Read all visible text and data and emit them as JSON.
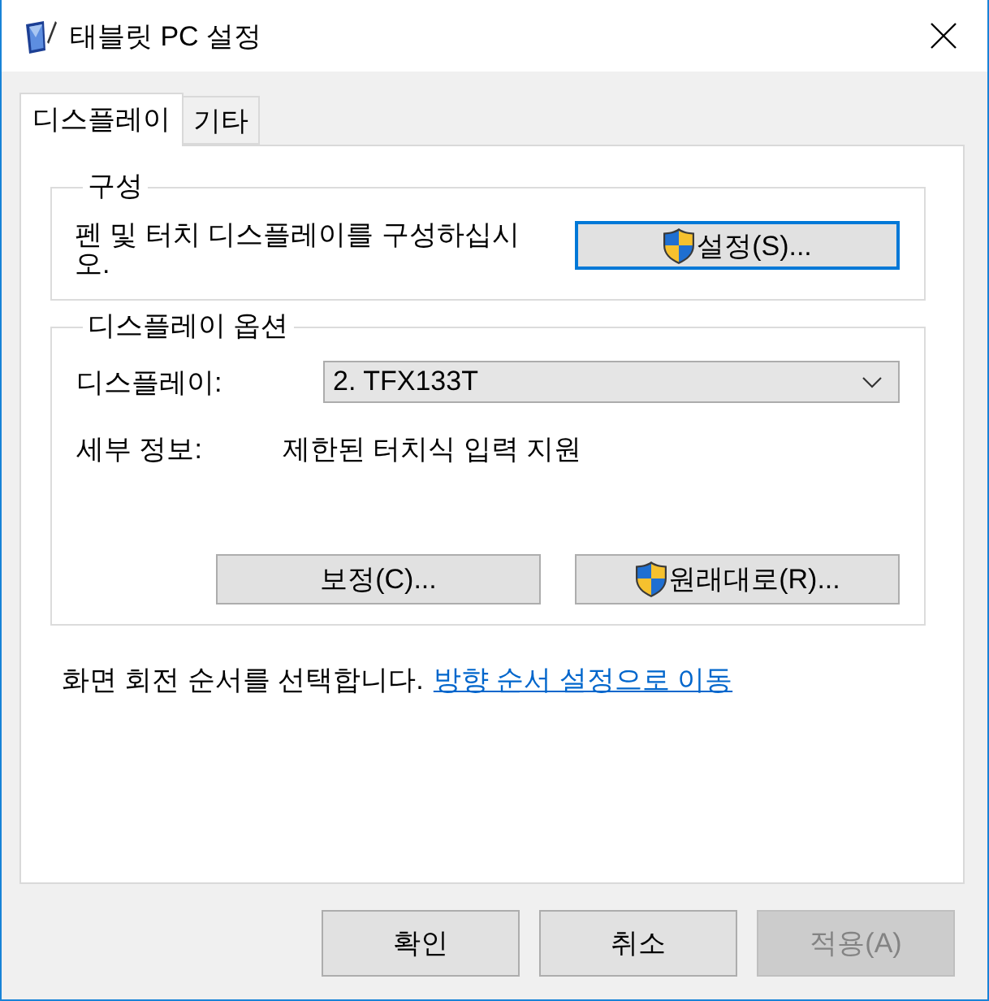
{
  "window": {
    "title": "태블릿 PC 설정"
  },
  "tabs": [
    {
      "label": "디스플레이",
      "selected": true
    },
    {
      "label": "기타",
      "selected": false
    }
  ],
  "configure_group": {
    "legend": "구성",
    "description": "펜 및 터치 디스플레이를 구성하십시오.",
    "button": {
      "label": "설정(S)...",
      "shield": true,
      "focused": true
    }
  },
  "display_options": {
    "legend": "디스플레이 옵션",
    "display_label": "디스플레이:",
    "display_select": {
      "value": "2. TFX133T"
    },
    "details_label": "세부 정보:",
    "details_value": "제한된 터치식 입력 지원",
    "buttons": [
      {
        "label": "보정(C)...",
        "shield": false
      },
      {
        "label": "원래대로(R)...",
        "shield": true
      }
    ]
  },
  "rotation": {
    "text": "화면 회전 순서를 선택합니다.",
    "link": "방향 순서 설정으로 이동"
  },
  "footer_buttons": [
    {
      "label": "확인",
      "disabled": false
    },
    {
      "label": "취소",
      "disabled": false
    },
    {
      "label": "적용(A)",
      "disabled": true
    }
  ]
}
